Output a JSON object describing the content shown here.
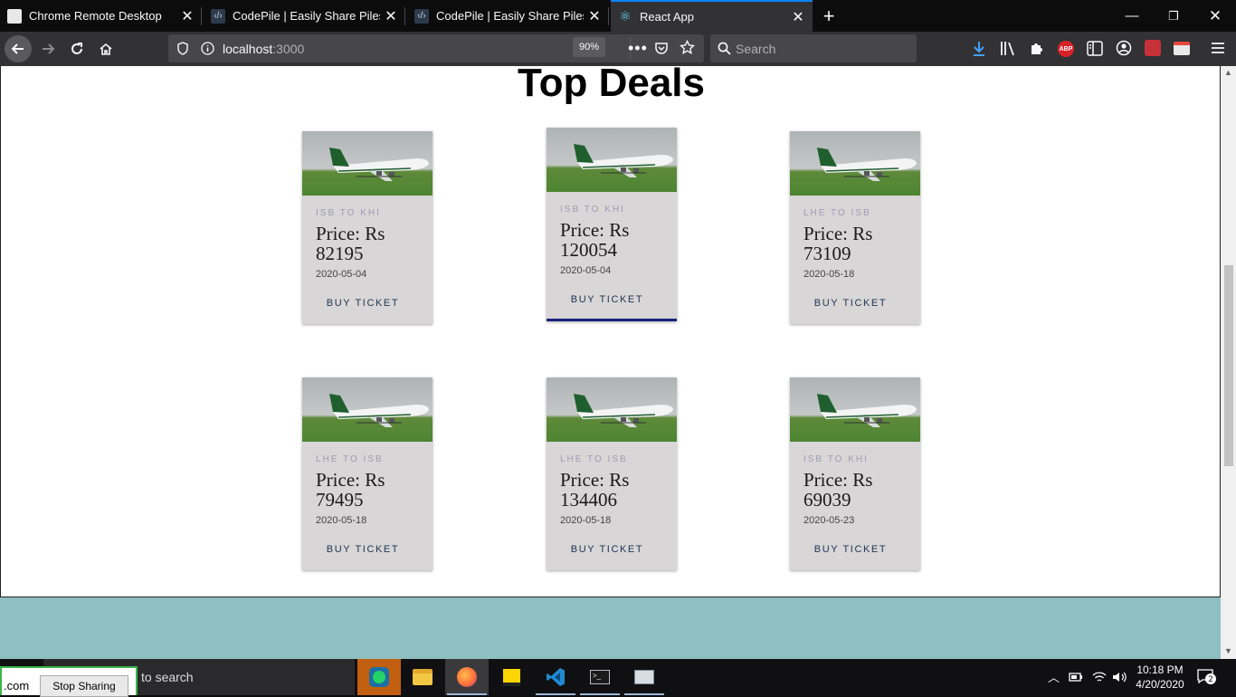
{
  "tabs": [
    {
      "title": "Chrome Remote Desktop",
      "favicon": "chrome-remote-desktop-icon",
      "active": false
    },
    {
      "title": "CodePile | Easily Share Piles of",
      "favicon": "codepile-icon",
      "active": false
    },
    {
      "title": "CodePile | Easily Share Piles of",
      "favicon": "codepile-icon",
      "active": false
    },
    {
      "title": "React App",
      "favicon": "react-icon",
      "active": true
    }
  ],
  "toolbar": {
    "url_host": "localhost",
    "url_port": ":3000",
    "zoom": "90%",
    "search_placeholder": "Search"
  },
  "page": {
    "heading": "Top Deals",
    "buy_label": "BUY TICKET",
    "deals": [
      {
        "route": "ISB TO KHI",
        "price": "Price: Rs 82195",
        "date": "2020-05-04"
      },
      {
        "route": "ISB TO KHI",
        "price": "Price: Rs 120054",
        "date": "2020-05-04"
      },
      {
        "route": "LHE TO ISB",
        "price": "Price: Rs 73109",
        "date": "2020-05-18"
      },
      {
        "route": "LHE TO ISB",
        "price": "Price: Rs 79495",
        "date": "2020-05-18"
      },
      {
        "route": "LHE TO ISB",
        "price": "Price: Rs 134406",
        "date": "2020-05-18"
      },
      {
        "route": "ISB TO KHI",
        "price": "Price: Rs 69039",
        "date": "2020-05-23"
      }
    ]
  },
  "taskbar": {
    "search_text": "to search",
    "share_domain": ".com",
    "stop_sharing": "Stop Sharing",
    "time": "10:18 PM",
    "date": "4/20/2020",
    "notifications": "2"
  },
  "colors": {
    "accent": "#0a84ff",
    "card_bg": "#d8d6d6",
    "hover_underline": "#1a237e",
    "backdrop": "#8fbfc1"
  }
}
